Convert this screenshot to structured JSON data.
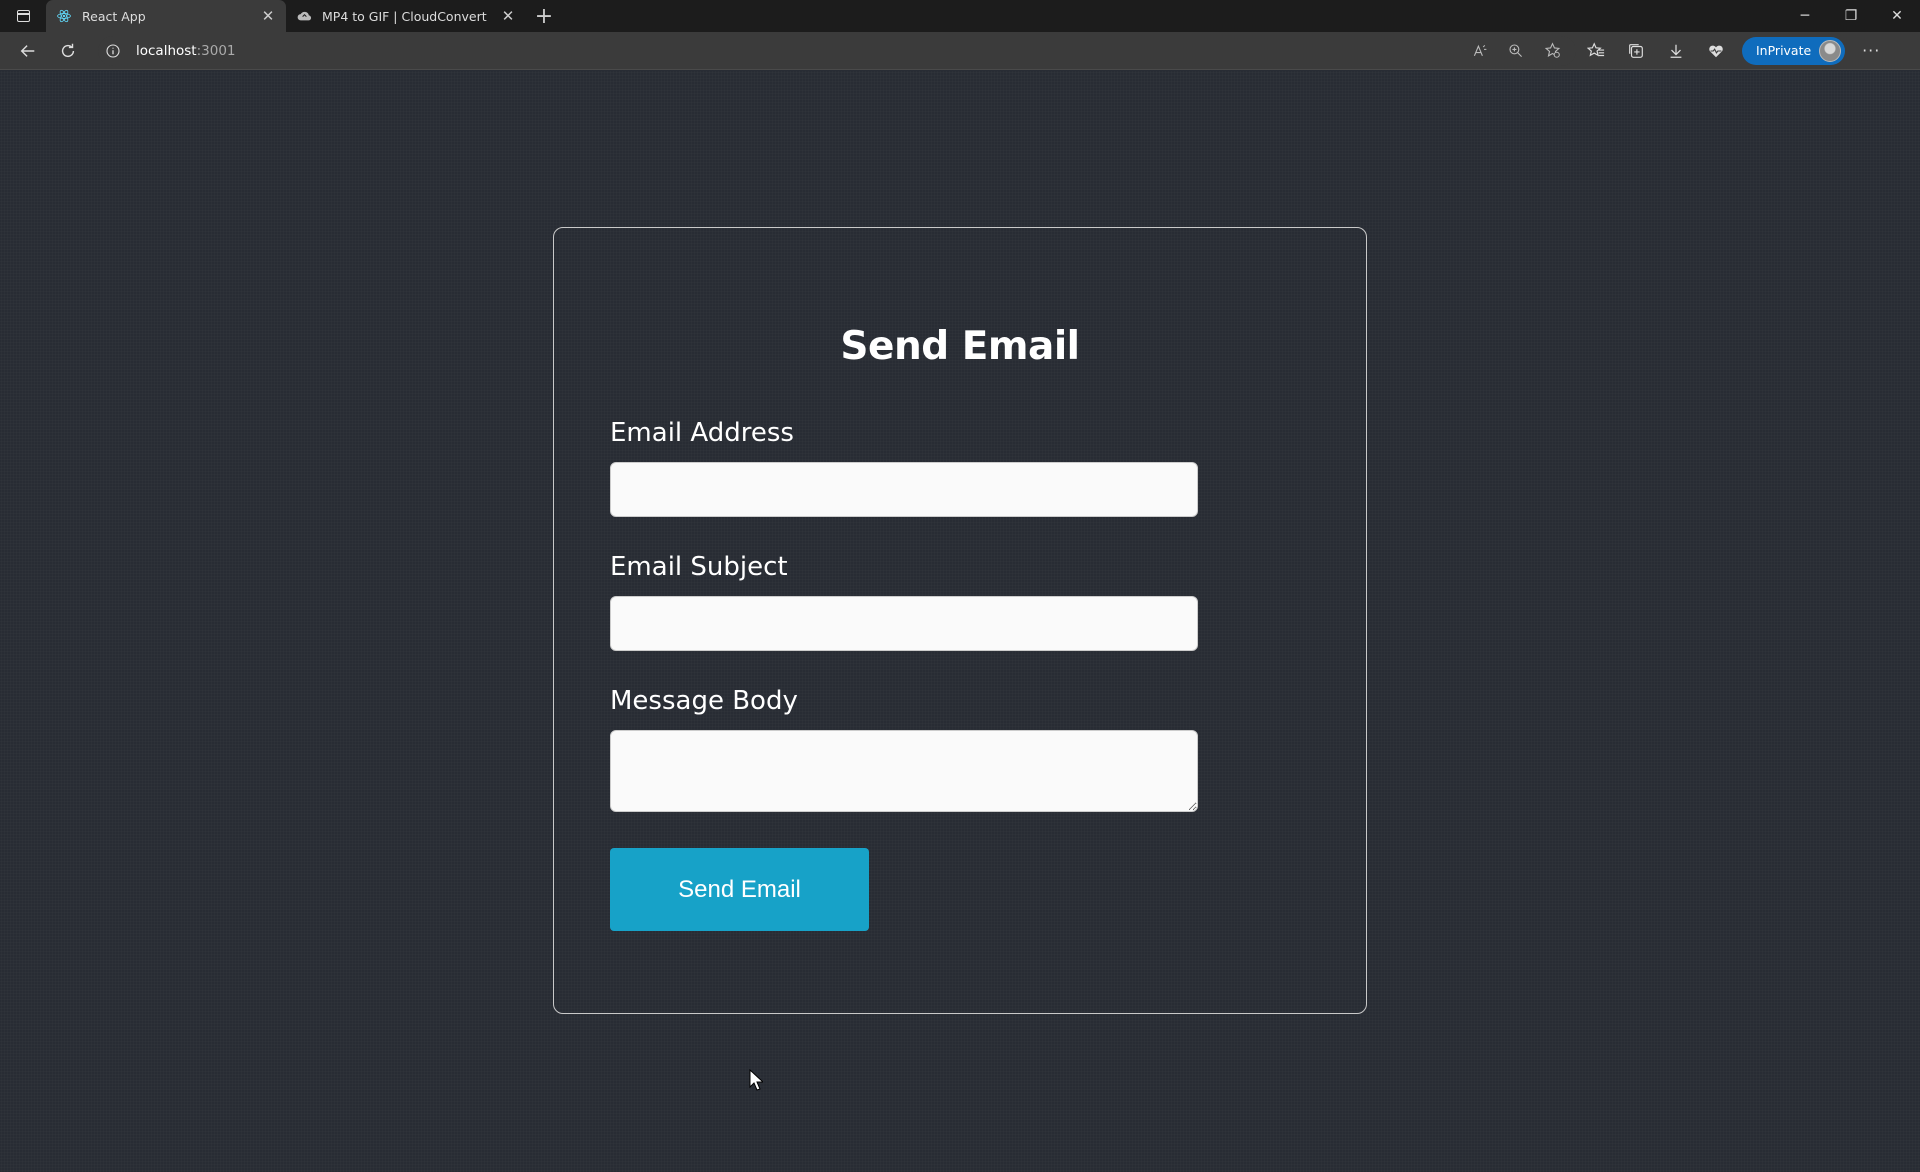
{
  "browser": {
    "tabs": [
      {
        "title": "React App",
        "favicon": "react-icon",
        "active": true
      },
      {
        "title": "MP4 to GIF | CloudConvert",
        "favicon": "cloudconvert-icon",
        "active": false
      }
    ],
    "address": {
      "host": "localhost",
      "port": ":3001"
    },
    "inprivate_label": "InPrivate",
    "accent": "#0f6cbd"
  },
  "page": {
    "heading": "Send Email",
    "fields": {
      "email_address": {
        "label": "Email Address",
        "value": ""
      },
      "email_subject": {
        "label": "Email Subject",
        "value": ""
      },
      "message_body": {
        "label": "Message Body",
        "value": ""
      }
    },
    "submit_label": "Send Email",
    "submit_color": "#17a2c8",
    "background_color": "#282c34"
  }
}
